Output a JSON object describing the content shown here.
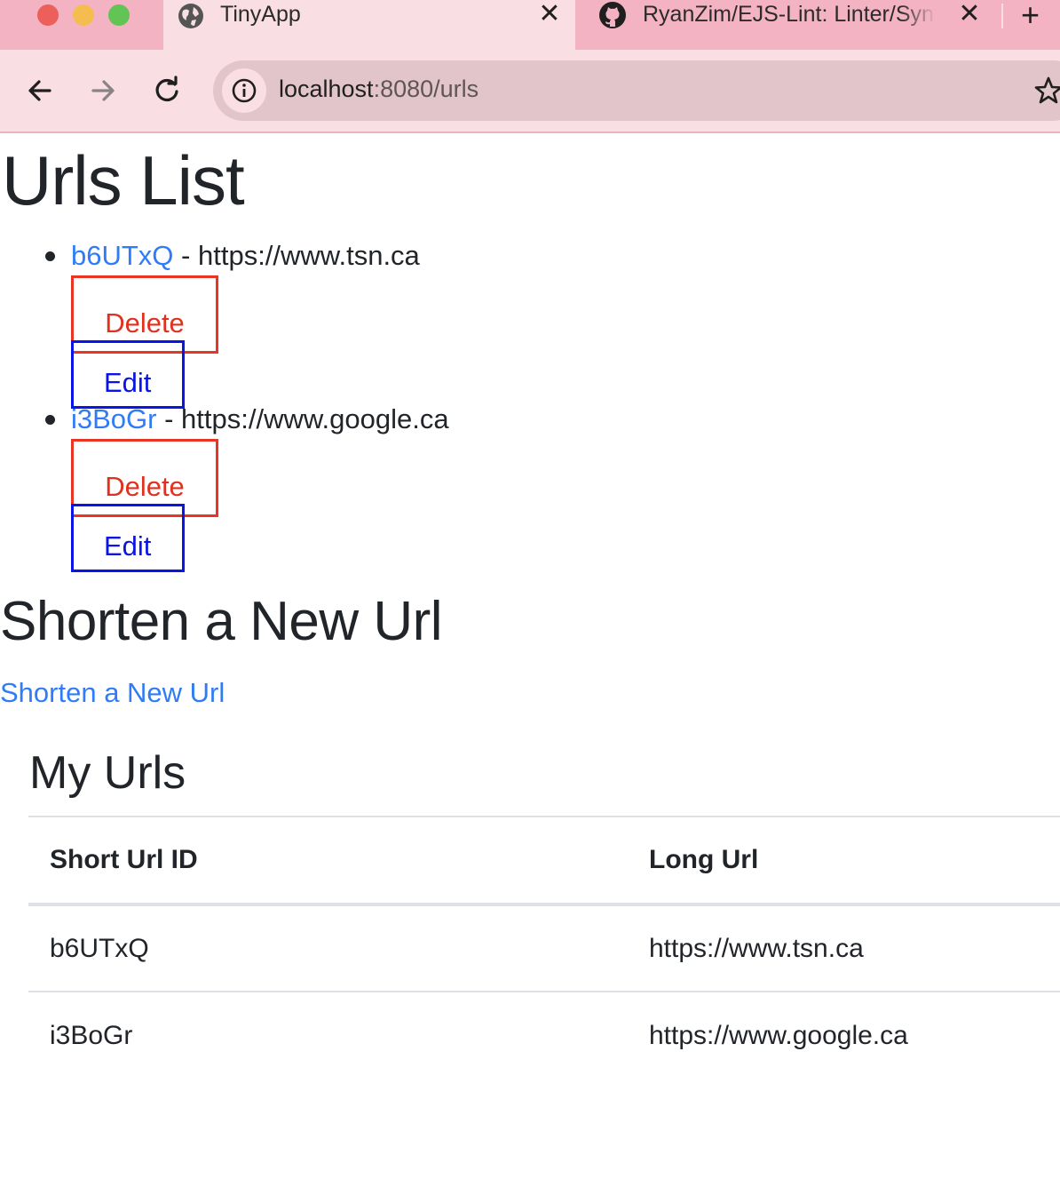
{
  "browser": {
    "tabs": [
      {
        "title": "TinyApp",
        "icon": "globe-icon",
        "active": true
      },
      {
        "title": "RyanZim/EJS-Lint: Linter/Syntax",
        "icon": "github-icon",
        "active": false
      }
    ],
    "address": {
      "host": "localhost",
      "path": ":8080/urls"
    }
  },
  "page": {
    "title": "Urls List",
    "urls": [
      {
        "short": "b6UTxQ",
        "separator": " - ",
        "long": "https://www.tsn.ca",
        "delete_label": "Delete",
        "edit_label": "Edit"
      },
      {
        "short": "i3BoGr",
        "separator": " - ",
        "long": "https://www.google.ca",
        "delete_label": "Delete",
        "edit_label": "Edit"
      }
    ],
    "shorten_heading": "Shorten a New Url",
    "shorten_link": "Shorten a New Url",
    "my_urls_heading": "My Urls",
    "table": {
      "headers": [
        "Short Url ID",
        "Long Url"
      ],
      "rows": [
        [
          "b6UTxQ",
          "https://www.tsn.ca"
        ],
        [
          "i3BoGr",
          "https://www.google.ca"
        ]
      ]
    }
  },
  "colors": {
    "link": "#2f7cf6",
    "delete": "#e83524",
    "edit": "#0a14e6",
    "tabbar": "#f4b3c2",
    "toolbar": "#f9dee4"
  }
}
